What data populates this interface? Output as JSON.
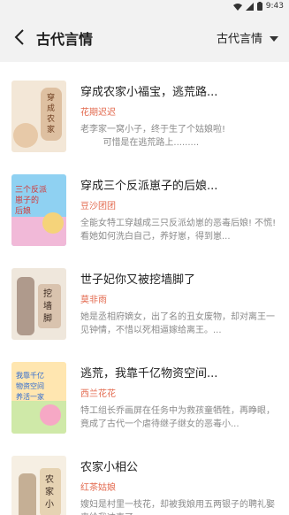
{
  "status": {
    "time": "9:43"
  },
  "header": {
    "title": "古代言情",
    "category": "古代言情"
  },
  "books": [
    {
      "title": "穿成农家小福宝，逃荒路...",
      "author": "花期迟迟",
      "desc": "老李家一窝小子，终于生了个姑娘啦!\n        可惜是在逃荒路上.........",
      "cover_text": "穿成农家小福宝",
      "cover_colors": [
        "#f3e7d7",
        "#e7c9a8",
        "#c99a6b"
      ]
    },
    {
      "title": "穿成三个反派崽子的后娘...",
      "author": "豆沙团团",
      "desc": "全能女特工穿越成三只反派幼崽的恶毒后娘! 不慌! 看她如何洗白自己，养好崽，得到崽...",
      "cover_text": "三个反派崽子的后娘怎么办",
      "cover_colors": [
        "#8fd1f2",
        "#f1b9d8",
        "#f5d37a"
      ]
    },
    {
      "title": "世子妃你又被挖墙脚了",
      "author": "莫非雨",
      "desc": "她是丞相府嫡女，出了名的丑女废物，却对离王一见钟情，不惜以死相逼嫁给离王。...",
      "cover_text": "挖墙脚",
      "cover_colors": [
        "#efe7dc",
        "#d9c3ae",
        "#7a5b4b"
      ]
    },
    {
      "title": "逃荒，我靠千亿物资空间...",
      "author": "西兰花花",
      "desc": "特工组长乔画屏在任务中为救孩童牺牲，再睁眼，竟成了古代一个虐待继子继女的恶毒小...",
      "cover_text": "我靠千亿物资空间养活一家",
      "cover_colors": [
        "#ffe6b0",
        "#cfe9a8",
        "#f6a8c5"
      ]
    },
    {
      "title": "农家小相公",
      "author": "红茶姑娘",
      "desc": "嫂妇是村里一枝花，却被我娘用五两银子的聘礼娶来给我冲喜了。",
      "cover_text": "农家小相公",
      "cover_colors": [
        "#f6efe3",
        "#e6d3b3",
        "#9c7a55"
      ]
    }
  ]
}
